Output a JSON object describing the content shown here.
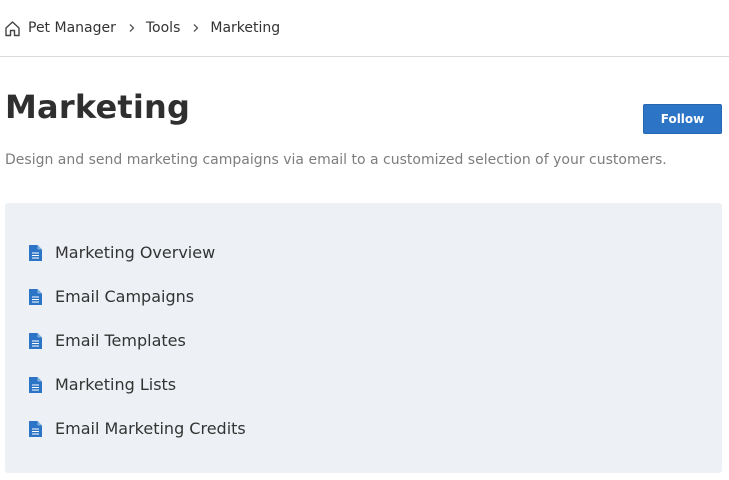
{
  "breadcrumb": {
    "items": [
      "Pet Manager",
      "Tools",
      "Marketing"
    ],
    "icons": {
      "home": "home-icon",
      "separator": "chevron-right-icon"
    }
  },
  "header": {
    "title": "Marketing",
    "follow_label": "Follow",
    "description": "Design and send marketing campaigns via email to a customized selection of your customers."
  },
  "articles": {
    "icon": "document-icon",
    "items": [
      {
        "label": "Marketing Overview"
      },
      {
        "label": "Email Campaigns"
      },
      {
        "label": "Email Templates"
      },
      {
        "label": "Marketing Lists"
      },
      {
        "label": "Email Marketing Credits"
      }
    ]
  },
  "colors": {
    "accent": "#2c74c6",
    "panel_background": "#edf1f5",
    "text": "#333333",
    "muted_text": "#7d7d7d"
  }
}
